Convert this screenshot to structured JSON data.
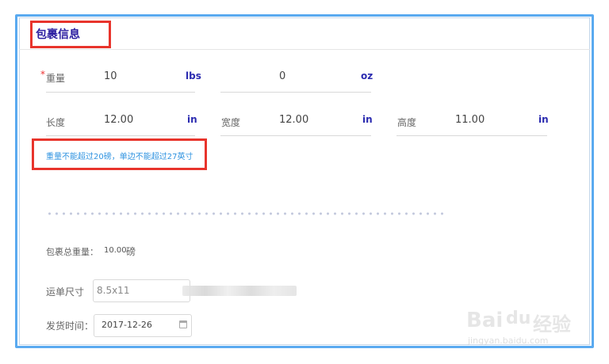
{
  "section": {
    "title": "包裹信息"
  },
  "weight": {
    "label": "重量",
    "required_mark": "*",
    "lbs_value": "10",
    "lbs_unit": "lbs",
    "oz_value": "0",
    "oz_unit": "oz"
  },
  "dimensions": {
    "length": {
      "label": "长度",
      "value": "12.00",
      "unit": "in"
    },
    "width": {
      "label": "宽度",
      "value": "12.00",
      "unit": "in"
    },
    "height": {
      "label": "高度",
      "value": "11.00",
      "unit": "in"
    }
  },
  "hint": "重量不能超过20磅，单边不能超过27英寸",
  "total": {
    "label": "包裹总重量：",
    "value": "10.00",
    "unit": "磅"
  },
  "label_size": {
    "label": "运单尺寸",
    "value": "8.5x11"
  },
  "ship_date": {
    "label": "发货时间：",
    "value": "2017-12-26"
  },
  "watermark": {
    "brand": "Bai",
    "brand_paw": "du",
    "brand_cn": "经验",
    "url": "jingyan.baidu.com"
  },
  "colors": {
    "accent_border": "#5aaaf0",
    "highlight_red": "#e8342c",
    "title": "#2b1da0",
    "unit": "#2b2bb0",
    "hint": "#2f93e0"
  }
}
